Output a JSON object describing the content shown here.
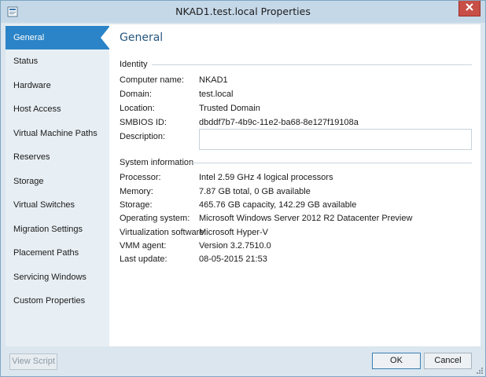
{
  "window": {
    "title": "NKAD1.test.local Properties"
  },
  "sidebar": {
    "items": [
      {
        "label": "General",
        "active": true
      },
      {
        "label": "Status"
      },
      {
        "label": "Hardware"
      },
      {
        "label": "Host Access"
      },
      {
        "label": "Virtual Machine Paths"
      },
      {
        "label": "Reserves"
      },
      {
        "label": "Storage"
      },
      {
        "label": "Virtual Switches"
      },
      {
        "label": "Migration Settings"
      },
      {
        "label": "Placement Paths"
      },
      {
        "label": "Servicing Windows"
      },
      {
        "label": "Custom Properties"
      }
    ]
  },
  "main": {
    "heading": "General",
    "identity": {
      "section_title": "Identity",
      "rows": [
        {
          "label": "Computer name:",
          "value": "NKAD1"
        },
        {
          "label": "Domain:",
          "value": "test.local"
        },
        {
          "label": "Location:",
          "value": "Trusted Domain"
        },
        {
          "label": "SMBIOS ID:",
          "value": "dbddf7b7-4b9c-11e2-ba68-8e127f19108a"
        }
      ],
      "description_label": "Description:",
      "description_value": ""
    },
    "system": {
      "section_title": "System information",
      "rows": [
        {
          "label": "Processor:",
          "value": "Intel  2.59 GHz 4 logical processors"
        },
        {
          "label": "Memory:",
          "value": "7.87 GB total, 0 GB available"
        },
        {
          "label": "Storage:",
          "value": "465.76 GB capacity, 142.29 GB available"
        },
        {
          "label": "Operating system:",
          "value": "Microsoft Windows Server 2012 R2 Datacenter Preview"
        },
        {
          "label": "Virtualization software:",
          "value": "Microsoft Hyper-V"
        },
        {
          "label": "VMM agent:",
          "value": "Version 3.2.7510.0"
        },
        {
          "label": "Last update:",
          "value": "08-05-2015 21:53"
        }
      ]
    }
  },
  "footer": {
    "view_script_label": "View Script",
    "ok_label": "OK",
    "cancel_label": "Cancel"
  },
  "icons": {
    "window_icon": "server-properties-icon",
    "close": "close-icon"
  },
  "colors": {
    "accent": "#2b84c7",
    "heading": "#27577f",
    "close": "#c74f48"
  }
}
